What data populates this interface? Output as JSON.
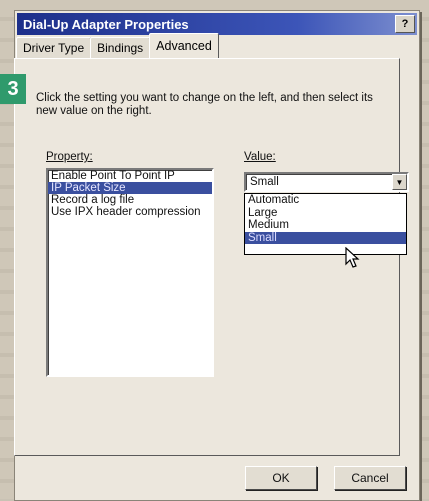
{
  "window": {
    "title": "Dial-Up Adapter Properties",
    "help_label": "?",
    "close_label": "x"
  },
  "tabs": [
    {
      "label": "Driver Type",
      "active": false
    },
    {
      "label": "Bindings",
      "active": false
    },
    {
      "label": "Advanced",
      "active": true
    }
  ],
  "step_badge": "3",
  "instructions": "Click the setting you want to change on the left, and then select its new value on the right.",
  "property": {
    "label": "Property:",
    "items": [
      {
        "label": "Enable Point To Point IP",
        "selected": false
      },
      {
        "label": "IP Packet Size",
        "selected": true
      },
      {
        "label": "Record a log file",
        "selected": false
      },
      {
        "label": "Use IPX header compression",
        "selected": false
      }
    ]
  },
  "value": {
    "label": "Value:",
    "current": "Small",
    "options": [
      {
        "label": "Automatic",
        "selected": false
      },
      {
        "label": "Large",
        "selected": false
      },
      {
        "label": "Medium",
        "selected": false
      },
      {
        "label": "Small",
        "selected": true
      }
    ]
  },
  "buttons": {
    "ok": "OK",
    "cancel": "Cancel"
  },
  "colors": {
    "title_bar": "#1d2f8a",
    "selection": "#3a4f9f",
    "step_badge": "#2f9a6c"
  }
}
